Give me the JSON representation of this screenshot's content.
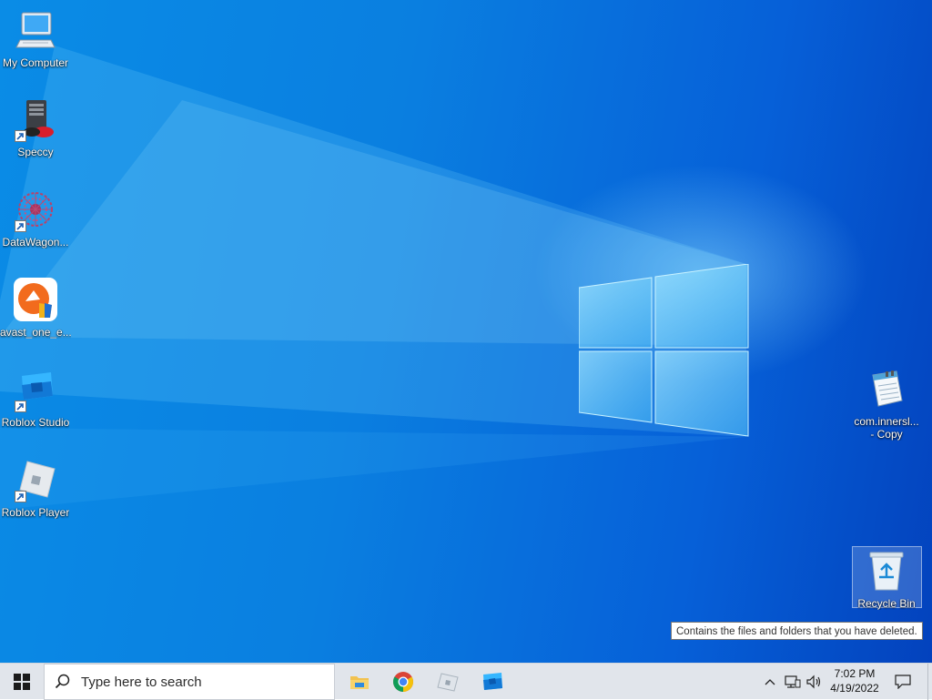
{
  "desktop": {
    "icons_left": [
      {
        "label": "My Computer",
        "icon": "computer-icon",
        "shortcut": false
      },
      {
        "label": "Speccy",
        "icon": "speccy-icon",
        "shortcut": true
      },
      {
        "label": "DataWagon...",
        "icon": "datawagon-icon",
        "shortcut": true
      },
      {
        "label": "avast_one_e...",
        "icon": "avast-icon",
        "shortcut": false
      },
      {
        "label": "Roblox Studio",
        "icon": "roblox-studio-icon",
        "shortcut": true
      },
      {
        "label": "Roblox Player",
        "icon": "roblox-player-icon",
        "shortcut": true
      }
    ],
    "icons_right": [
      {
        "label": "com.innersl...\n- Copy",
        "icon": "notepad-file-icon"
      },
      {
        "label": "Recycle Bin",
        "icon": "recycle-bin-icon"
      }
    ],
    "tooltip": "Contains the files and folders that you have deleted."
  },
  "taskbar": {
    "start_icon": "windows-start-icon",
    "search_placeholder": "Type here to search",
    "apps": [
      {
        "name": "File Explorer",
        "icon": "folder-icon"
      },
      {
        "name": "Google Chrome",
        "icon": "chrome-icon"
      },
      {
        "name": "Roblox Player",
        "icon": "roblox-player-icon"
      },
      {
        "name": "Roblox Studio",
        "icon": "roblox-studio-icon"
      }
    ],
    "tray": {
      "chevron_icon": "chevron-up-icon",
      "network_icon": "network-icon",
      "volume_icon": "volume-icon",
      "time": "7:02 PM",
      "date": "4/19/2022",
      "notifications_icon": "notification-icon"
    }
  },
  "colors": {
    "desktop_blue": "#0a7fe0",
    "taskbar_bg": "#e1e5eb"
  }
}
